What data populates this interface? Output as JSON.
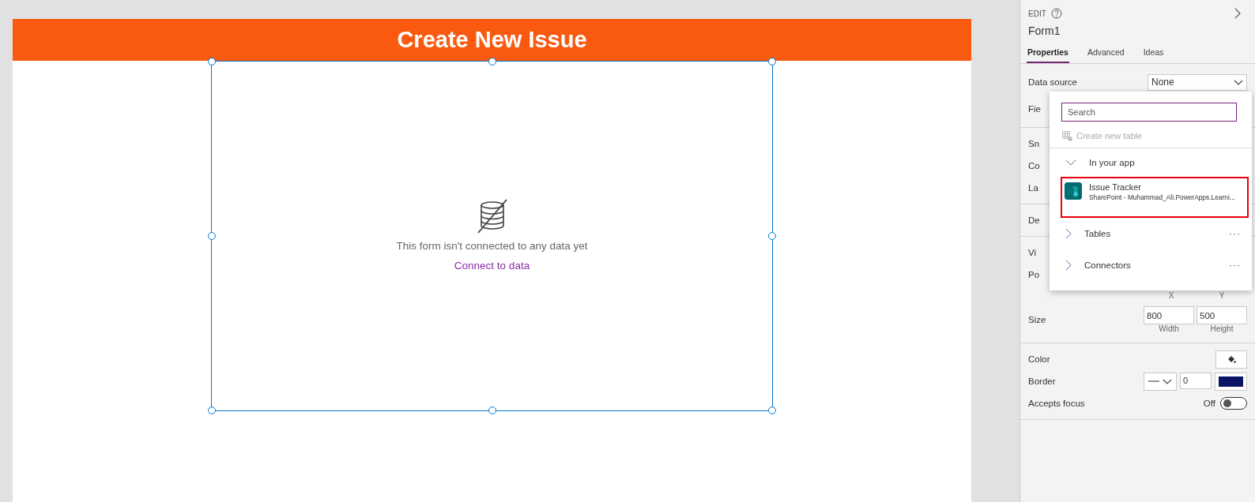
{
  "canvas": {
    "header_title": "Create New Issue",
    "form": {
      "selected": true,
      "message": "This form isn't connected to any data yet",
      "link": "Connect to data"
    }
  },
  "panel": {
    "mode": "EDIT",
    "control_name": "Form1",
    "tabs": [
      {
        "label": "Properties",
        "selected": true
      },
      {
        "label": "Advanced",
        "selected": false
      },
      {
        "label": "Ideas",
        "selected": false
      }
    ],
    "sections": [
      {
        "rows": [
          {
            "kind": "dropdown",
            "label": "Data source",
            "value": "None"
          },
          {
            "kind": "label",
            "label": "Fie"
          }
        ]
      },
      {
        "rows": [
          {
            "kind": "label",
            "label": "Sn"
          },
          {
            "kind": "label",
            "label": "Co"
          },
          {
            "kind": "label",
            "label": "La"
          }
        ]
      },
      {
        "rows": [
          {
            "kind": "label",
            "label": "De"
          }
        ]
      },
      {
        "rows": [
          {
            "kind": "label",
            "label": "Vi"
          },
          {
            "kind": "label",
            "label": "Po"
          },
          {
            "kind": "captions",
            "captions": [
              "X",
              "Y"
            ]
          },
          {
            "kind": "pair",
            "label": "Size",
            "values": [
              "800",
              "500"
            ],
            "captions": [
              "Width",
              "Height"
            ]
          }
        ]
      },
      {
        "rows": [
          {
            "kind": "color",
            "label": "Color"
          },
          {
            "kind": "border",
            "label": "Border",
            "value": "0",
            "color": "#0b1464"
          },
          {
            "kind": "toggle",
            "label": "Accepts focus",
            "state_text": "Off",
            "on": false
          }
        ]
      }
    ]
  },
  "popup": {
    "search_placeholder": "Search",
    "create_label": "Create new table",
    "groups": [
      {
        "label": "In your app",
        "expanded": true,
        "items": [
          {
            "title": "Issue Tracker",
            "subtitle": "SharePoint - Muhammad_Ali.PowerApps.Learni...",
            "highlighted": true
          }
        ]
      },
      {
        "label": "Tables",
        "expanded": false,
        "more": "···"
      },
      {
        "label": "Connectors",
        "expanded": false,
        "more": "···"
      }
    ]
  }
}
